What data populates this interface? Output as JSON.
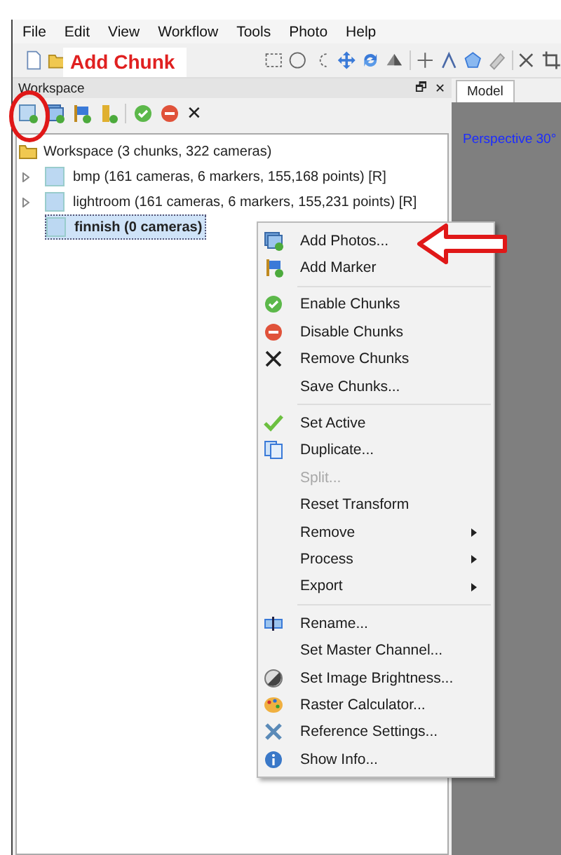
{
  "menu_bar": [
    "File",
    "Edit",
    "View",
    "Workflow",
    "Tools",
    "Photo",
    "Help"
  ],
  "annotation": {
    "label": "Add Chunk"
  },
  "workspace": {
    "title": "Workspace",
    "float_glyph": "🗗",
    "close_glyph": "✕",
    "remove_glyph": "✕",
    "tree": {
      "label": "Workspace (3 chunks, 322 cameras)",
      "expanded": true,
      "children": [
        {
          "label": "bmp (161 cameras, 6 markers, 155,168 points) [R]",
          "expanded": false,
          "selected": false,
          "active": false
        },
        {
          "label": "lightroom (161 cameras, 6 markers, 155,231 points) [R]",
          "expanded": false,
          "selected": false,
          "active": false
        },
        {
          "label": "finnish (0 cameras)",
          "selected": true,
          "active": true
        }
      ]
    }
  },
  "context_menu": [
    {
      "kind": "item",
      "label": "Add Photos...",
      "disabled": false,
      "submenu": false
    },
    {
      "kind": "item",
      "label": "Add Marker",
      "disabled": false,
      "submenu": false
    },
    {
      "kind": "separator"
    },
    {
      "kind": "item",
      "label": "Enable Chunks",
      "disabled": false,
      "submenu": false
    },
    {
      "kind": "item",
      "label": "Disable Chunks",
      "disabled": false,
      "submenu": false
    },
    {
      "kind": "item",
      "label": "Remove Chunks",
      "disabled": false,
      "submenu": false
    },
    {
      "kind": "item",
      "label": "Save Chunks...",
      "disabled": false,
      "submenu": false
    },
    {
      "kind": "separator"
    },
    {
      "kind": "item",
      "label": "Set Active",
      "disabled": false,
      "submenu": false
    },
    {
      "kind": "item",
      "label": "Duplicate...",
      "disabled": false,
      "submenu": false
    },
    {
      "kind": "item",
      "label": "Split...",
      "disabled": true,
      "submenu": false
    },
    {
      "kind": "item",
      "label": "Reset Transform",
      "disabled": false,
      "submenu": false
    },
    {
      "kind": "item",
      "label": "Remove",
      "disabled": false,
      "submenu": true
    },
    {
      "kind": "item",
      "label": "Process",
      "disabled": false,
      "submenu": true
    },
    {
      "kind": "item",
      "label": "Export",
      "disabled": false,
      "submenu": true
    },
    {
      "kind": "separator"
    },
    {
      "kind": "item",
      "label": "Rename...",
      "disabled": false,
      "submenu": false
    },
    {
      "kind": "item",
      "label": "Set Master Channel...",
      "disabled": false,
      "submenu": false
    },
    {
      "kind": "item",
      "label": "Set Image Brightness...",
      "disabled": false,
      "submenu": false
    },
    {
      "kind": "item",
      "label": "Raster Calculator...",
      "disabled": false,
      "submenu": false
    },
    {
      "kind": "item",
      "label": "Reference Settings...",
      "disabled": false,
      "submenu": false
    },
    {
      "kind": "item",
      "label": "Show Info...",
      "disabled": false,
      "submenu": false
    }
  ],
  "view_panel": {
    "tabs": [
      {
        "label": "Model",
        "selected": true
      }
    ],
    "projection": "Perspective 30°"
  }
}
